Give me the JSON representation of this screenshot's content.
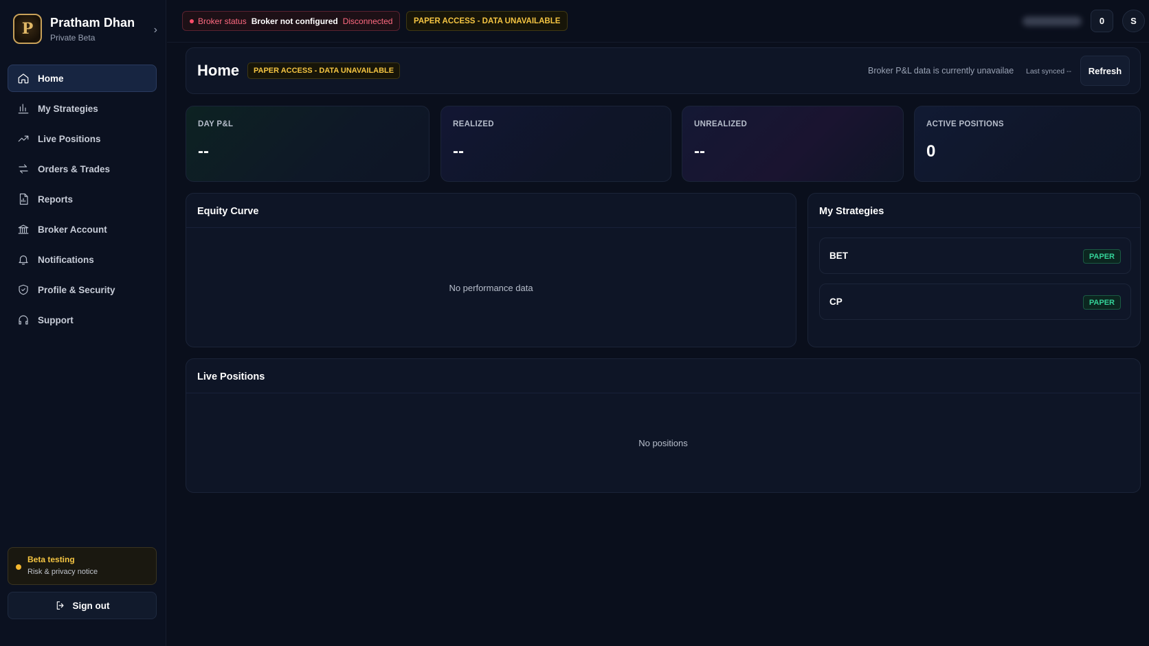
{
  "brand": {
    "logo_letter": "P",
    "name": "Pratham Dhan",
    "subtitle": "Private Beta"
  },
  "sidebar": {
    "items": [
      {
        "label": "Home",
        "icon": "home-icon",
        "active": true
      },
      {
        "label": "My Strategies",
        "icon": "bar-chart-icon"
      },
      {
        "label": "Live Positions",
        "icon": "trending-up-icon"
      },
      {
        "label": "Orders & Trades",
        "icon": "swap-arrows-icon"
      },
      {
        "label": "Reports",
        "icon": "report-icon"
      },
      {
        "label": "Broker Account",
        "icon": "bank-icon"
      },
      {
        "label": "Notifications",
        "icon": "bell-icon"
      },
      {
        "label": "Profile & Security",
        "icon": "shield-icon"
      },
      {
        "label": "Support",
        "icon": "headset-icon"
      }
    ],
    "beta": {
      "title": "Beta testing",
      "subtitle": "Risk & privacy notice"
    },
    "signout_label": "Sign out"
  },
  "topbar": {
    "broker_status_label": "Broker status",
    "broker_status_value": "Broker not configured",
    "broker_state": "Disconnected",
    "paper_badge": "PAPER ACCESS - DATA UNAVAILABLE",
    "notification_count": "0",
    "avatar_initial": "S"
  },
  "header": {
    "title": "Home",
    "badge": "PAPER ACCESS - DATA UNAVAILABLE",
    "pnl_note": "Broker P&L data is currently unavailae",
    "last_synced": "Last synced --",
    "refresh_label": "Refresh"
  },
  "stats": [
    {
      "label": "DAY P&L",
      "value": "--"
    },
    {
      "label": "REALIZED",
      "value": "--"
    },
    {
      "label": "UNREALIZED",
      "value": "--"
    },
    {
      "label": "ACTIVE POSITIONS",
      "value": "0"
    }
  ],
  "equity": {
    "title": "Equity Curve",
    "empty": "No performance data"
  },
  "strategies": {
    "title": "My Strategies",
    "items": [
      {
        "name": "BET",
        "mode": "PAPER"
      },
      {
        "name": "CP",
        "mode": "PAPER"
      }
    ]
  },
  "live_positions": {
    "title": "Live Positions",
    "empty": "No positions"
  },
  "colors": {
    "background": "#0a0f1c",
    "accent_warning": "#f5c542",
    "status_error": "#ff6a80",
    "paper_green": "#34d399"
  }
}
